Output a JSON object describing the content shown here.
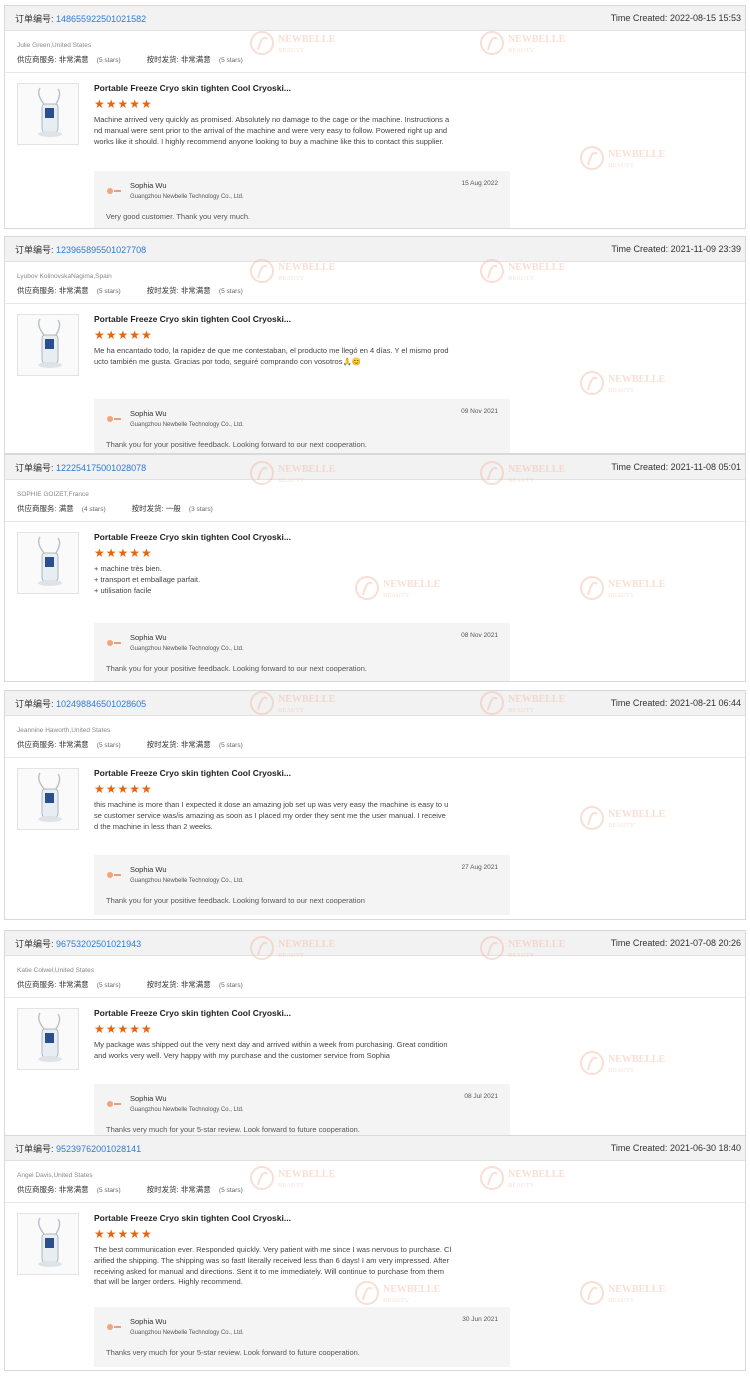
{
  "labels": {
    "order_prefix": "订单编号:",
    "time_prefix": "Time Created:",
    "supplier_service": "供应商服务:",
    "on_time_shipping": "按时发货:"
  },
  "brand": {
    "accent": "#e8650f",
    "link": "#2d7bd5",
    "watermark": "NEWBELLE",
    "watermark_sub": "BEAUTY"
  },
  "reviews": [
    {
      "order_no": "148655922501021582",
      "time": "2022-08-15 15:53",
      "buyer": "Julie Green,United States",
      "service_rating": "非常满意",
      "service_stars": "(5 stars)",
      "shipping_rating": "非常满意",
      "shipping_stars": "(5 stars)",
      "product_title": "Portable Freeze Cryo skin tighten Cool Cryoski...",
      "stars": "★★★★★",
      "review": "Machine arrived very quickly as promised. Absolutely no damage to the cage or the machine. Instructions a\nnd manual were sent prior to the arrival of the machine and were very easy to follow. Powered right up and\nworks like it should. I highly recommend anyone looking to buy a machine like this to contact this supplier.",
      "reply_name": "Sophia Wu",
      "reply_company": "Guangzhou Newbelle Technology Co., Ltd.",
      "reply_date": "15 Aug 2022",
      "reply_text": "Very good customer. Thank you very much."
    },
    {
      "order_no": "123965895501027708",
      "time": "2021-11-09 23:39",
      "buyer": "Lyubov KolinovskaNagima,Spain",
      "service_rating": "非常满意",
      "service_stars": "(5 stars)",
      "shipping_rating": "非常满意",
      "shipping_stars": "(5 stars)",
      "product_title": "Portable Freeze Cryo skin tighten Cool Cryoski...",
      "stars": "★★★★★",
      "review": "Me ha encantado todo, la rapidez de que me contestaban, el producto me llegó en 4 días. Y el mismo prod\nucto también me gusta. Gracias por todo, seguiré comprando con vosotros🙏😊",
      "reply_name": "Sophia Wu",
      "reply_company": "Guangzhou Newbelle Technology Co., Ltd.",
      "reply_date": "09 Nov 2021",
      "reply_text": "Thank you for your positive feedback. Looking forward to our next cooperation."
    },
    {
      "order_no": "122254175001028078",
      "time": "2021-11-08 05:01",
      "buyer": "SOPHIE GOIZET,France",
      "service_rating": "满意",
      "service_stars": "(4 stars)",
      "shipping_rating": "一般",
      "shipping_stars": "(3 stars)",
      "product_title": "Portable Freeze Cryo skin tighten Cool Cryoski...",
      "stars": "★★★★★",
      "review": "+ machine très bien.\n+ transport et emballage parfait.\n+ utilisation facile",
      "reply_name": "Sophia Wu",
      "reply_company": "Guangzhou Newbelle Technology Co., Ltd.",
      "reply_date": "08 Nov 2021",
      "reply_text": "Thank you for your positive feedback. Looking forward to our next cooperation."
    },
    {
      "order_no": "102498846501028605",
      "time": "2021-08-21 06:44",
      "buyer": "Jeannine Haworth,United States",
      "service_rating": "非常满意",
      "service_stars": "(5 stars)",
      "shipping_rating": "非常满意",
      "shipping_stars": "(5 stars)",
      "product_title": "Portable Freeze Cryo skin tighten Cool Cryoski...",
      "stars": "★★★★★",
      "review": "this machine is more than I expected it dose an amazing job set up was very easy the machine is easy to u\nse  customer service was/is amazing as soon as I placed my order they sent me the user manual. I receive\nd the machine in less than 2 weeks.",
      "reply_name": "Sophia Wu",
      "reply_company": "Guangzhou Newbelle Technology Co., Ltd.",
      "reply_date": "27 Aug 2021",
      "reply_text": "Thank you for your positive feedback. Looking forward to our next cooperation"
    },
    {
      "order_no": "96753202501021943",
      "time": "2021-07-08 20:26",
      "buyer": "Katie Colwel,United States",
      "service_rating": "非常满意",
      "service_stars": "(5 stars)",
      "shipping_rating": "非常满意",
      "shipping_stars": "(5 stars)",
      "product_title": "Portable Freeze Cryo skin tighten Cool Cryoski...",
      "stars": "★★★★★",
      "review": "My package was shipped out the very next day and arrived within a week from purchasing. Great condition\nand works very well. Very happy with my purchase and the customer service from Sophia",
      "reply_name": "Sophia Wu",
      "reply_company": "Guangzhou Newbelle Technology Co., Ltd.",
      "reply_date": "08 Jul 2021",
      "reply_text": "Thanks very much for your 5-star review. Look forward to future cooperation."
    },
    {
      "order_no": "95239762001028141",
      "time": "2021-06-30 18:40",
      "buyer": "Angel Davis,United States",
      "service_rating": "非常满意",
      "service_stars": "(5 stars)",
      "shipping_rating": "非常满意",
      "shipping_stars": "(5 stars)",
      "product_title": "Portable Freeze Cryo skin tighten Cool Cryoski...",
      "stars": "★★★★★",
      "review": "The best communication ever. Responded quickly. Very patient with me since I was nervous to purchase. Cl\narified the shipping. The shipping was so fast! literally received less than 6 days! I am very impressed. After\nreceiving asked for manual and directions. Sent it to me immediately. Will continue to purchase from them\nthat will be larger orders. Highly recommend.",
      "reply_name": "Sophia Wu",
      "reply_company": "Guangzhou Newbelle Technology Co., Ltd.",
      "reply_date": "30 Jun 2021",
      "reply_text": "Thanks very much for your 5-star review. Look forward to future cooperation."
    }
  ]
}
